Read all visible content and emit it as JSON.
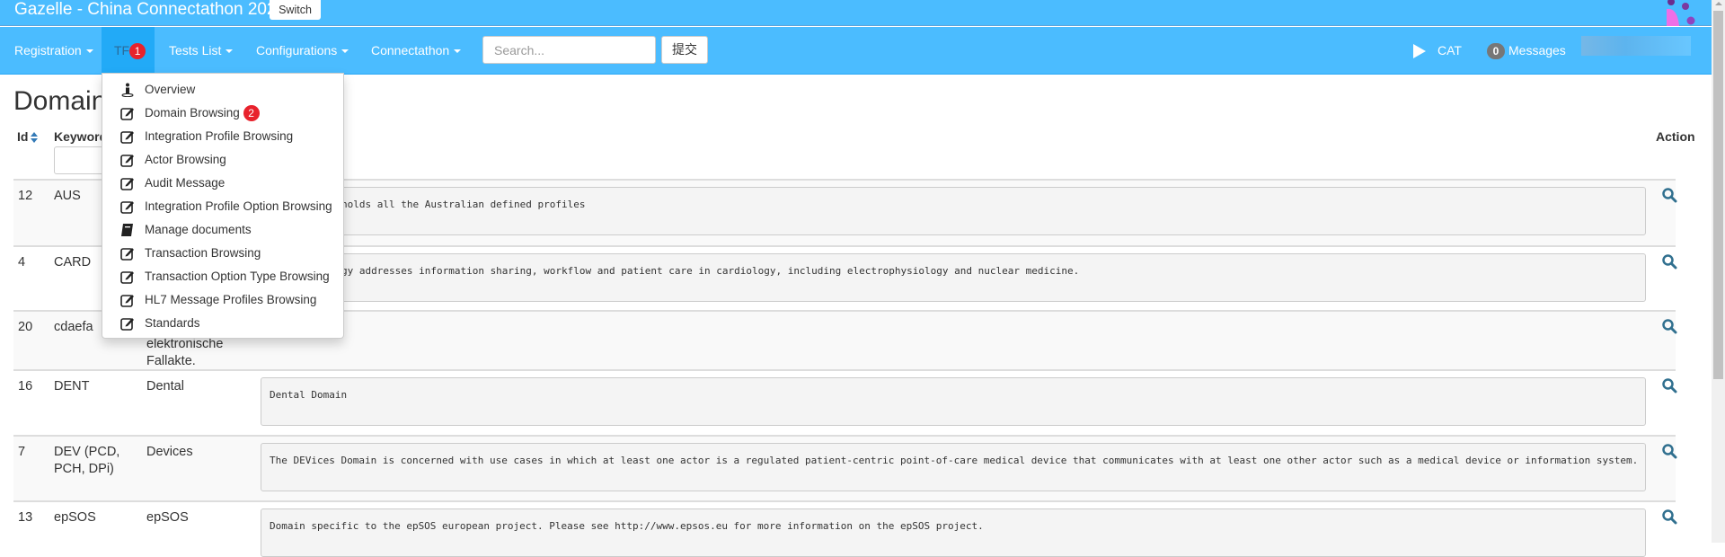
{
  "header": {
    "title": "Gazelle - China Connectathon 2023",
    "switch_label": "Switch"
  },
  "nav": {
    "items": [
      {
        "label": "Registration"
      },
      {
        "label": "TF",
        "marker": "1"
      },
      {
        "label": "Tests List"
      },
      {
        "label": "Configurations"
      },
      {
        "label": "Connectathon"
      }
    ],
    "search_placeholder": "Search...",
    "submit_label": "提交",
    "cat_label": "CAT",
    "messages_count": "0",
    "messages_label": "Messages"
  },
  "dropdown": {
    "items": [
      {
        "label": "Overview",
        "icon": "info-icon"
      },
      {
        "label": "Domain Browsing",
        "icon": "edit-icon",
        "marker": "2"
      },
      {
        "label": "Integration Profile Browsing",
        "icon": "edit-icon"
      },
      {
        "label": "Actor Browsing",
        "icon": "edit-icon"
      },
      {
        "label": "Audit Message",
        "icon": "edit-icon"
      },
      {
        "label": "Integration Profile Option Browsing",
        "icon": "edit-icon"
      },
      {
        "label": "Manage documents",
        "icon": "book-icon"
      },
      {
        "label": "Transaction Browsing",
        "icon": "edit-icon"
      },
      {
        "label": "Transaction Option Type Browsing",
        "icon": "edit-icon"
      },
      {
        "label": "HL7 Message Profiles Browsing",
        "icon": "edit-icon"
      },
      {
        "label": "Standards",
        "icon": "edit-icon"
      }
    ]
  },
  "page": {
    "title": "Domain"
  },
  "table": {
    "headers": {
      "id": "Id",
      "keyword": "Keyword",
      "action": "Action"
    },
    "rows": [
      {
        "id": "12",
        "keyword": "AUS",
        "name": "",
        "description": "holds all the Australian defined profiles"
      },
      {
        "id": "4",
        "keyword": "CARD",
        "name": "",
        "description": "gy addresses information sharing, workflow and patient care in cardiology, including electrophysiology and nuclear medicine."
      },
      {
        "id": "20",
        "keyword": "cdaefa",
        "name": "elektronische Fallakte.",
        "description": ""
      },
      {
        "id": "16",
        "keyword": "DENT",
        "name": "Dental",
        "description": "Dental Domain"
      },
      {
        "id": "7",
        "keyword": "DEV (PCD, PCH, DPi)",
        "name": "Devices",
        "description": "The DEVices Domain is concerned with use cases in which at least one actor is a regulated patient-centric point-of-care medical device that communicates with at least one other actor such as a medical device or information system."
      },
      {
        "id": "13",
        "keyword": "epSOS",
        "name": "epSOS",
        "description": "Domain specific to the epSOS european project. Please see http://www.epsos.eu for more information on the epSOS project."
      }
    ]
  },
  "colors": {
    "navbar": "#4bbcff",
    "active_nav": "#22aaf7",
    "marker": "#e8222c",
    "link": "#337ab7"
  }
}
